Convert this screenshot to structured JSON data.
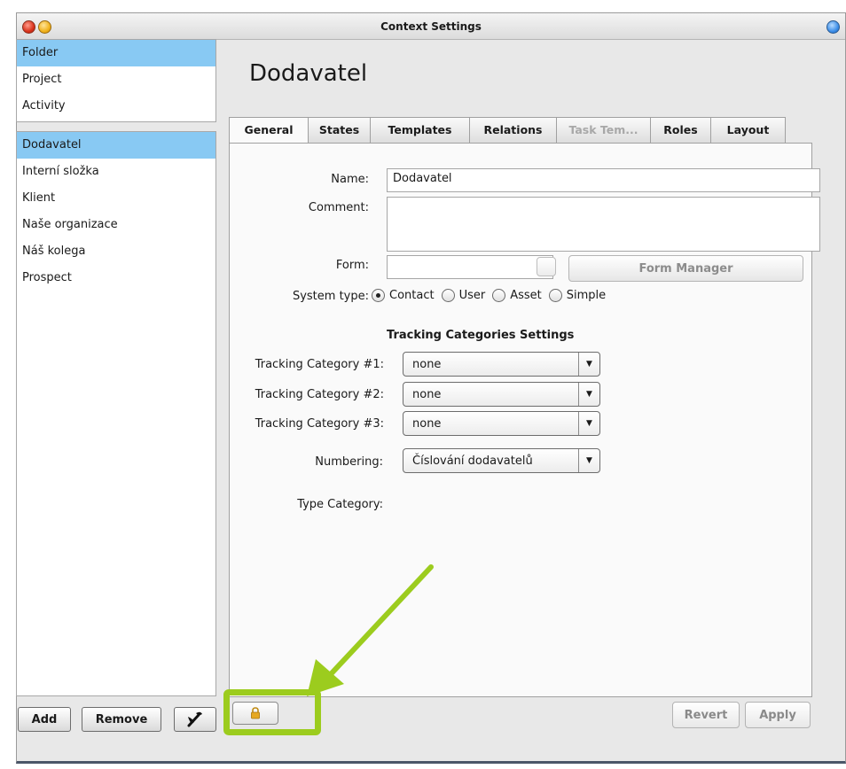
{
  "window": {
    "title": "Context Settings"
  },
  "sidebar": {
    "top_items": [
      {
        "label": "Folder",
        "selected": true
      },
      {
        "label": "Project",
        "selected": false
      },
      {
        "label": "Activity",
        "selected": false
      }
    ],
    "items": [
      {
        "label": "Dodavatel",
        "selected": true
      },
      {
        "label": "Interní složka",
        "selected": false
      },
      {
        "label": "Klient",
        "selected": false
      },
      {
        "label": "Naše organizace",
        "selected": false
      },
      {
        "label": "Náš kolega",
        "selected": false
      },
      {
        "label": "Prospect",
        "selected": false
      }
    ],
    "buttons": {
      "add": "Add",
      "remove": "Remove",
      "tools_icon": "tools-icon"
    }
  },
  "main": {
    "heading": "Dodavatel",
    "tabs": [
      {
        "label": "General",
        "active": true,
        "disabled": false
      },
      {
        "label": "States",
        "active": false,
        "disabled": false
      },
      {
        "label": "Templates",
        "active": false,
        "disabled": false
      },
      {
        "label": "Relations",
        "active": false,
        "disabled": false
      },
      {
        "label": "Task Tem...",
        "active": false,
        "disabled": true
      },
      {
        "label": "Roles",
        "active": false,
        "disabled": false
      },
      {
        "label": "Layout",
        "active": false,
        "disabled": false
      }
    ],
    "general": {
      "name_label": "Name:",
      "name_value": "Dodavatel",
      "comment_label": "Comment:",
      "comment_value": "",
      "form_label": "Form:",
      "form_value": "",
      "form_manager_button": "Form Manager",
      "system_type_label": "System type:",
      "system_types": [
        {
          "label": "Contact",
          "checked": true
        },
        {
          "label": "User",
          "checked": false
        },
        {
          "label": "Asset",
          "checked": false
        },
        {
          "label": "Simple",
          "checked": false
        }
      ],
      "tracking_title": "Tracking Categories Settings",
      "tracking_categories": [
        {
          "label": "Tracking Category #1:",
          "value": "none"
        },
        {
          "label": "Tracking Category #2:",
          "value": "none"
        },
        {
          "label": "Tracking Category #3:",
          "value": "none"
        }
      ],
      "numbering_label": "Numbering:",
      "numbering_value": "Číslování dodavatelů",
      "type_category_label": "Type Category:"
    },
    "footer": {
      "revert": "Revert",
      "apply": "Apply",
      "lock_icon": "lock-icon"
    }
  },
  "annotation": {
    "highlight_color": "#9ccc1e",
    "arrow_color": "#9ccc1e"
  }
}
